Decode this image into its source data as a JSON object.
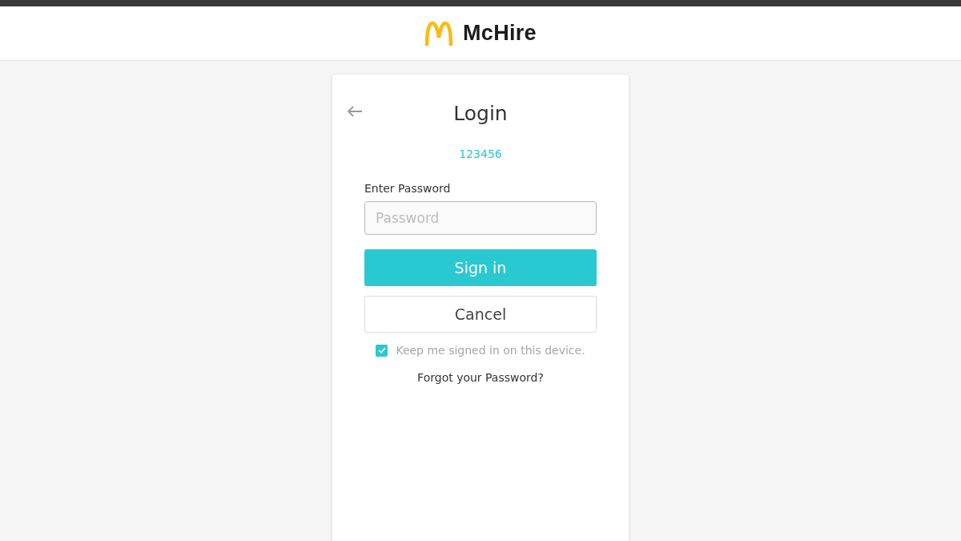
{
  "header": {
    "brand": "McHire"
  },
  "login": {
    "title": "Login",
    "account": "123456",
    "password_label": "Enter Password",
    "password": {
      "placeholder": "Password"
    },
    "buttons": [
      {
        "kind": "primary",
        "label": "Sign in"
      },
      {
        "kind": "secondary",
        "label": "Cancel"
      }
    ],
    "keep_signed_in": {
      "label": "Keep me signed in on this device.",
      "checked": true
    },
    "forgot_link": "Forgot your Password?"
  }
}
